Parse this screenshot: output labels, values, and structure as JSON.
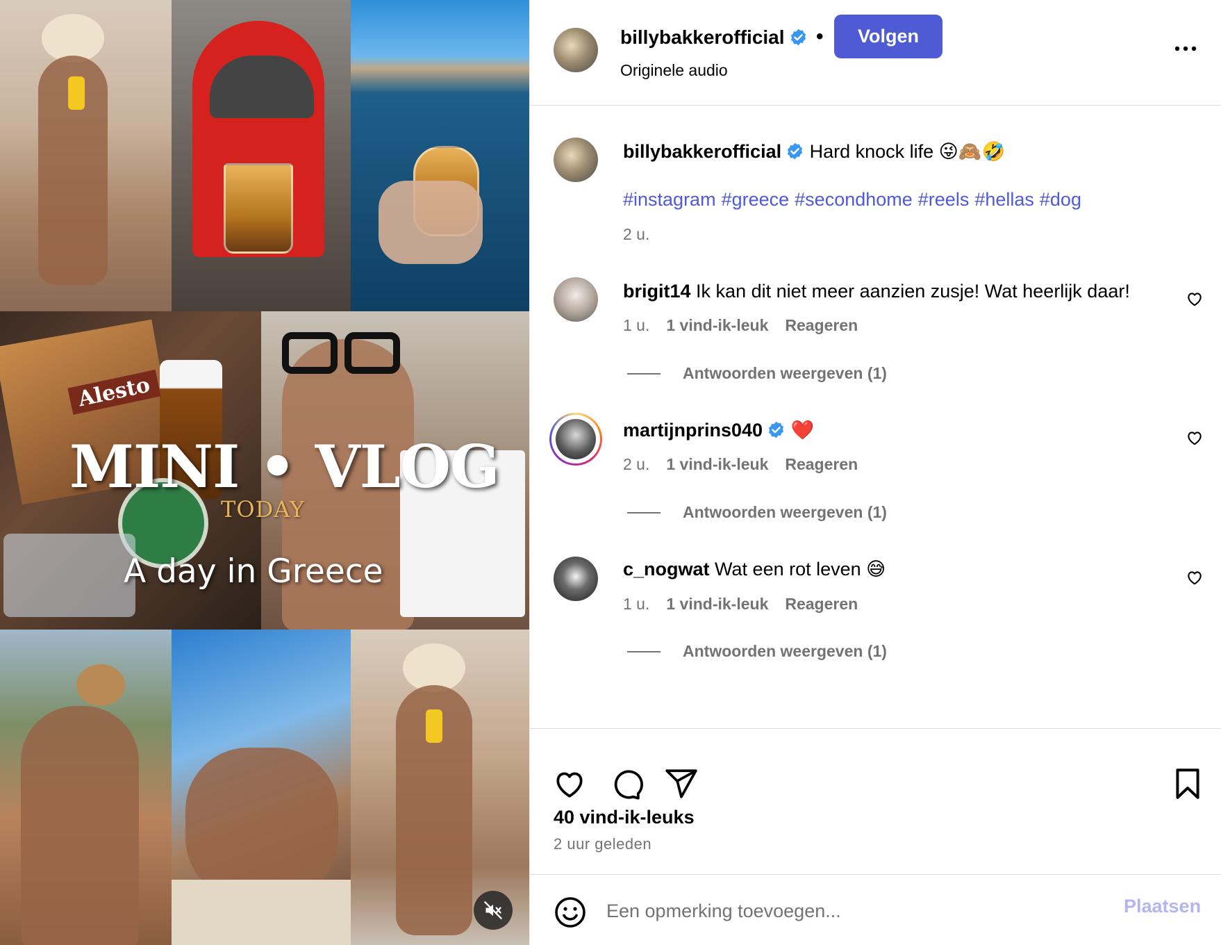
{
  "media": {
    "overlay_brand": "Alesto",
    "title": "MINI • VLOG",
    "today": "TODAY",
    "subtitle": "A day in Greece",
    "mute_icon": "speaker-muted-icon"
  },
  "header": {
    "username": "billybakkerofficial",
    "separator": "•",
    "follow_label": "Volgen",
    "audio_label": "Originele audio",
    "more_icon": "more-horizontal-icon"
  },
  "caption": {
    "username": "billybakkerofficial",
    "text": "Hard knock life 😜🙈🤣",
    "hashtags": [
      "#instagram",
      "#greece",
      "#secondhome",
      "#reels",
      "#hellas",
      "#dog"
    ],
    "time": "2 u."
  },
  "comments": [
    {
      "username": "brigit14",
      "text": "Ik kan dit niet meer aanzien zusje! Wat heerlijk daar!",
      "time": "1 u.",
      "likes": "1 vind-ik-leuk",
      "reply_label": "Reageren",
      "view_replies": "Antwoorden weergeven (1)"
    },
    {
      "username": "martijnprins040",
      "text": "❤️",
      "time": "2 u.",
      "likes": "1 vind-ik-leuk",
      "reply_label": "Reageren",
      "view_replies": "Antwoorden weergeven (1)"
    },
    {
      "username": "c_nogwat",
      "text": "Wat een rot leven 😅",
      "time": "1 u.",
      "likes": "1 vind-ik-leuk",
      "reply_label": "Reageren",
      "view_replies": "Antwoorden weergeven (1)"
    }
  ],
  "actions": {
    "like_count": "40 vind-ik-leuks",
    "posted": "2 uur geleden"
  },
  "comment_box": {
    "placeholder": "Een opmerking toevoegen...",
    "post_label": "Plaatsen"
  },
  "colors": {
    "accent": "#4f5bd5",
    "verified": "#3897f0",
    "muted_text": "#737373",
    "post_disabled": "#b2b5ee"
  }
}
